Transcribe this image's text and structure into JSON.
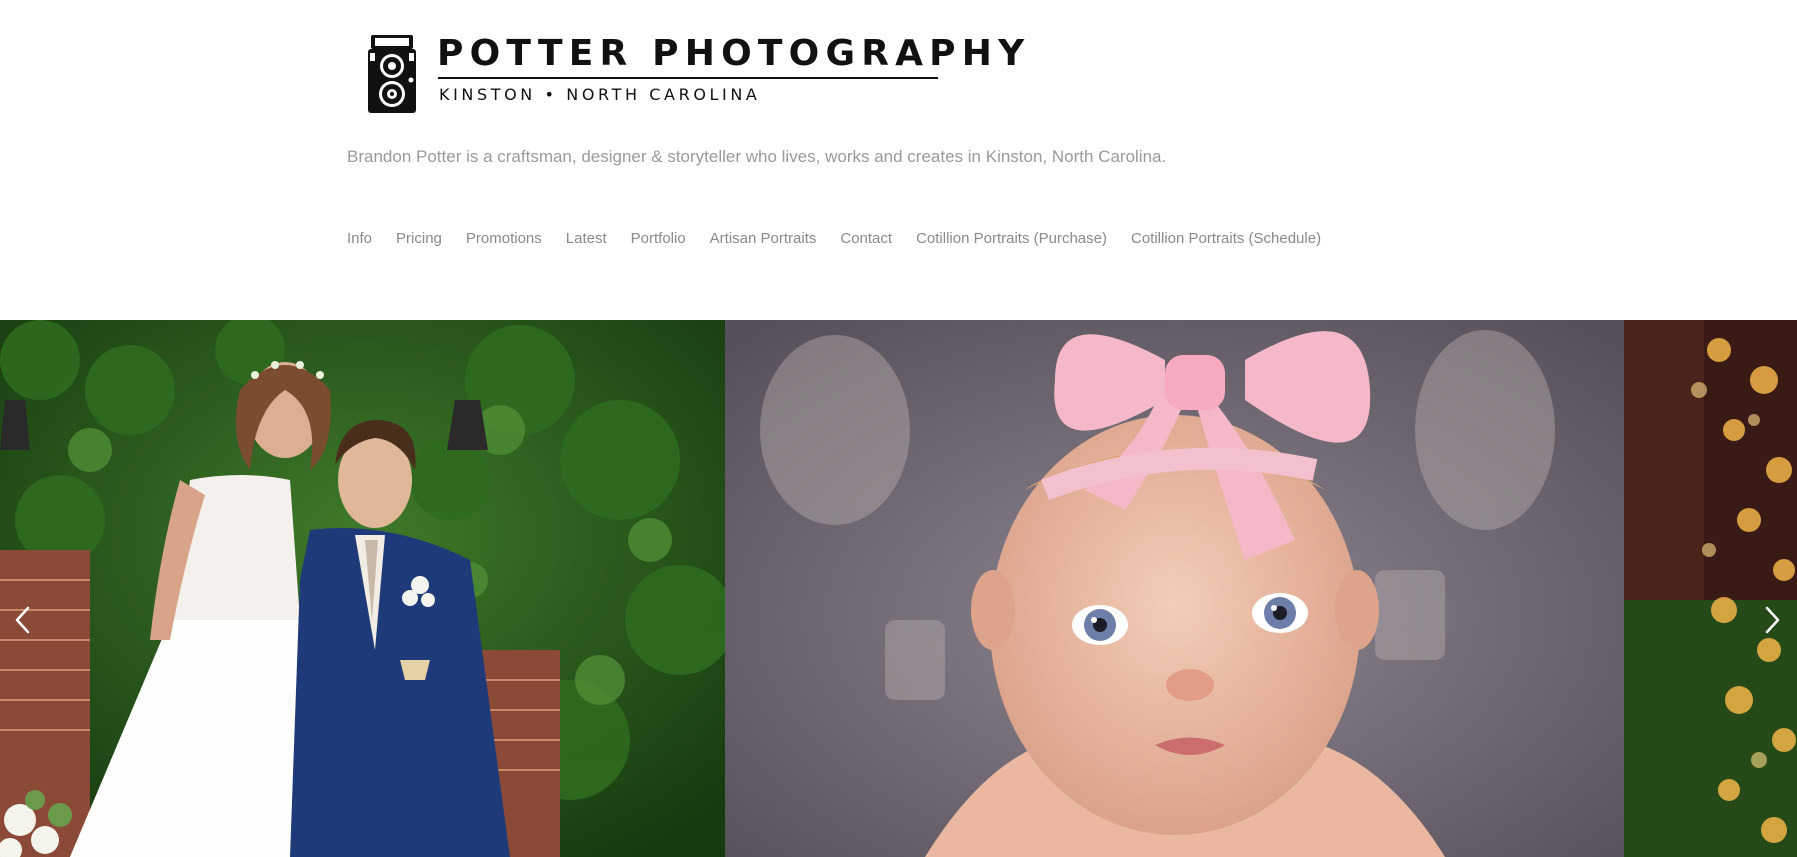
{
  "brand": {
    "title": "POTTER PHOTOGRAPHY",
    "subtitle": "KINSTON • NORTH CAROLINA",
    "logo_icon": "vintage-twin-lens-camera-icon"
  },
  "tagline": "Brandon Potter is a craftsman, designer & storyteller who lives, works and creates in Kinston, North Carolina.",
  "nav": {
    "items": [
      {
        "label": "Info"
      },
      {
        "label": "Pricing"
      },
      {
        "label": "Promotions"
      },
      {
        "label": "Latest"
      },
      {
        "label": "Portfolio"
      },
      {
        "label": "Artisan Portraits"
      },
      {
        "label": "Contact"
      },
      {
        "label": "Cotillion Portraits (Purchase)"
      },
      {
        "label": "Cotillion Portraits (Schedule)"
      }
    ]
  },
  "gallery": {
    "slides": [
      {
        "name": "wedding-couple-photo"
      },
      {
        "name": "baby-pink-bow-photo"
      },
      {
        "name": "bokeh-lights-photo"
      }
    ],
    "prev_icon": "chevron-left-icon",
    "next_icon": "chevron-right-icon"
  },
  "colors": {
    "text_dark": "#111111",
    "nav_text": "#8a8a8a",
    "tagline_text": "#9a9a9a",
    "arrow": "#ffffff"
  }
}
